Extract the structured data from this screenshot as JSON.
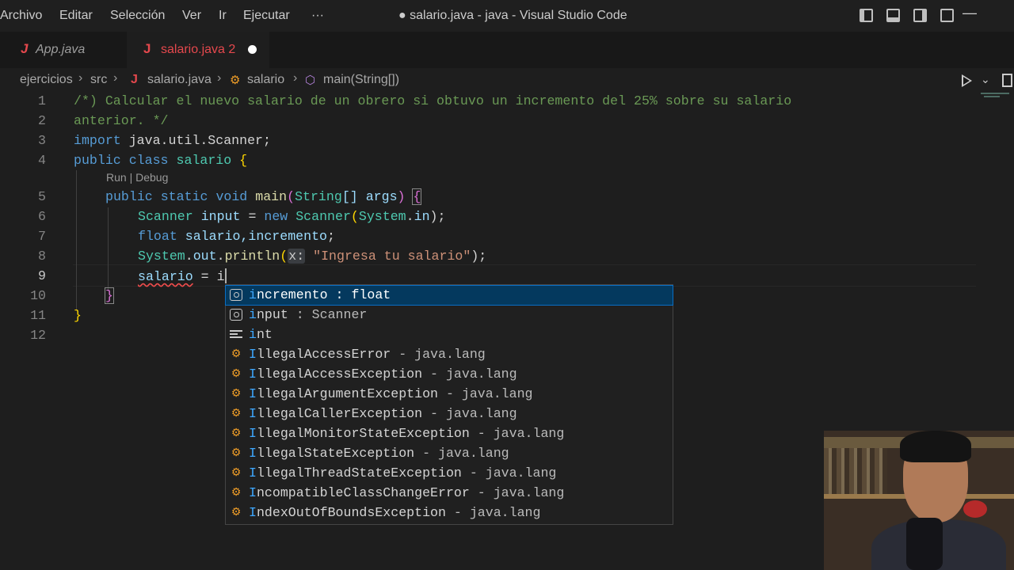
{
  "menubar": {
    "items": [
      "Archivo",
      "Editar",
      "Selección",
      "Ver",
      "Ir",
      "Ejecutar",
      "···"
    ],
    "window_title": "● salario.java - java - Visual Studio Code"
  },
  "tabs": [
    {
      "label": "App.java",
      "icon": "java-icon"
    },
    {
      "label": "salario.java 2",
      "icon": "java-icon",
      "modified": true
    }
  ],
  "breadcrumb": {
    "items": [
      "ejercicios",
      "src",
      "salario.java",
      "salario",
      "main(String[])"
    ]
  },
  "editor": {
    "line_numbers": [
      "1",
      "2",
      "3",
      "4",
      "5",
      "6",
      "7",
      "8",
      "9",
      "10",
      "11",
      "12"
    ],
    "codelens": "Run | Debug",
    "lines": {
      "l1": "/*) Calcular el nuevo salario de un obrero si obtuvo un incremento del 25% sobre su salario",
      "l2": "anterior. */",
      "l3_kw": "import",
      "l3_rest": " java.util.Scanner;",
      "l4_kw1": "public",
      "l4_kw2": "class",
      "l4_name": "salario",
      "l4_brace": "{",
      "l5_kw1": "public",
      "l5_kw2": "static",
      "l5_kw3": "void",
      "l5_fn": "main",
      "l5_p1": "(",
      "l5_type": "String",
      "l5_arr": "[]",
      "l5_arg": "args",
      "l5_p2": ")",
      "l5_brace": "{",
      "l6_type": "Scanner",
      "l6_var": "input",
      "l6_eq": " = ",
      "l6_new": "new",
      "l6_type2": "Scanner",
      "l6_p1": "(",
      "l6_sys": "System",
      "l6_dot": ".",
      "l6_in": "in",
      "l6_end": ");",
      "l7_type": "float",
      "l7_vars": "salario,incremento",
      "l7_end": ";",
      "l8_sys": "System",
      "l8_dot": ".",
      "l8_out": "out",
      "l8_dot2": ".",
      "l8_fn": "println",
      "l8_p1": "(",
      "l8_hint": "x:",
      "l8_str": "\"Ingresa tu salario\"",
      "l8_end": ");",
      "l9_var": "salario",
      "l9_rest": " = i",
      "l10": "}",
      "l11": "}"
    }
  },
  "suggestions": [
    {
      "prefix": "i",
      "rest": "ncremento",
      "detail": " : float",
      "icon": "variable-icon",
      "selected": true
    },
    {
      "prefix": "i",
      "rest": "nput",
      "detail": " : Scanner",
      "icon": "variable-icon"
    },
    {
      "prefix": "i",
      "rest": "nt",
      "detail": "",
      "icon": "keyword-icon"
    },
    {
      "prefix": "I",
      "rest": "llegalAccessError",
      "detail": " - java.lang",
      "icon": "class-icon"
    },
    {
      "prefix": "I",
      "rest": "llegalAccessException",
      "detail": " - java.lang",
      "icon": "class-icon"
    },
    {
      "prefix": "I",
      "rest": "llegalArgumentException",
      "detail": " - java.lang",
      "icon": "class-icon"
    },
    {
      "prefix": "I",
      "rest": "llegalCallerException",
      "detail": " - java.lang",
      "icon": "class-icon"
    },
    {
      "prefix": "I",
      "rest": "llegalMonitorStateException",
      "detail": " - java.lang",
      "icon": "class-icon"
    },
    {
      "prefix": "I",
      "rest": "llegalStateException",
      "detail": " - java.lang",
      "icon": "class-icon"
    },
    {
      "prefix": "I",
      "rest": "llegalThreadStateException",
      "detail": " - java.lang",
      "icon": "class-icon"
    },
    {
      "prefix": "I",
      "rest": "ncompatibleClassChangeError",
      "detail": " - java.lang",
      "icon": "class-icon"
    },
    {
      "prefix": "I",
      "rest": "ndexOutOfBoundsException",
      "detail": " - java.lang",
      "icon": "class-icon"
    }
  ],
  "colors": {
    "background": "#1e1e1e",
    "keyword": "#569cd6",
    "type": "#4ec9b0",
    "function": "#dcdcaa",
    "string": "#ce9178",
    "comment": "#6a9955",
    "selection": "#04395e"
  }
}
